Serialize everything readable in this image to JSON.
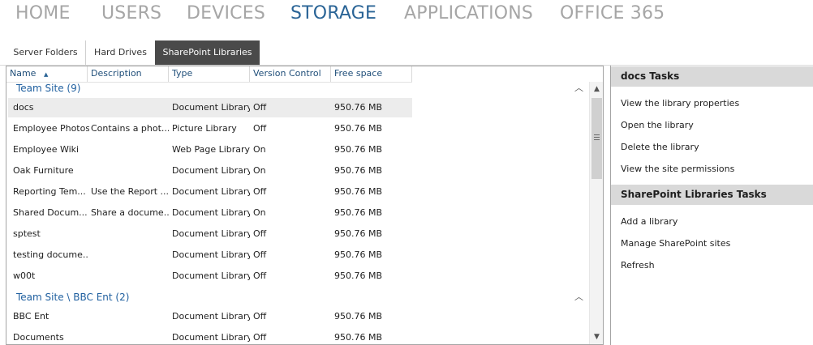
{
  "nav": {
    "items": [
      {
        "label": "HOME"
      },
      {
        "label": "USERS"
      },
      {
        "label": "DEVICES"
      },
      {
        "label": "STORAGE"
      },
      {
        "label": "APPLICATIONS"
      },
      {
        "label": "OFFICE 365"
      }
    ],
    "active": "STORAGE"
  },
  "tabs": {
    "items": [
      {
        "label": "Server Folders"
      },
      {
        "label": "Hard Drives"
      },
      {
        "label": "SharePoint Libraries"
      }
    ],
    "active": "SharePoint Libraries"
  },
  "list": {
    "columns": [
      {
        "label": "Name"
      },
      {
        "label": "Description"
      },
      {
        "label": "Type"
      },
      {
        "label": "Version Control"
      },
      {
        "label": "Free space"
      }
    ],
    "sort_column": "Name",
    "groups": [
      {
        "label": "Team Site (9)",
        "rows": [
          {
            "name": "docs",
            "description": "",
            "type": "Document Library",
            "version": "Off",
            "free": "950.76 MB",
            "selected": true
          },
          {
            "name": "Employee Photos",
            "description": "Contains a phot...",
            "type": "Picture Library",
            "version": "Off",
            "free": "950.76 MB"
          },
          {
            "name": "Employee Wiki",
            "description": "",
            "type": "Web Page Library",
            "version": "On",
            "free": "950.76 MB"
          },
          {
            "name": "Oak Furniture",
            "description": "",
            "type": "Document Library",
            "version": "On",
            "free": "950.76 MB"
          },
          {
            "name": "Reporting Tem...",
            "description": "Use the Report ...",
            "type": "Document Library",
            "version": "Off",
            "free": "950.76 MB"
          },
          {
            "name": "Shared Docum...",
            "description": "Share a docume...",
            "type": "Document Library",
            "version": "On",
            "free": "950.76 MB"
          },
          {
            "name": "sptest",
            "description": "",
            "type": "Document Library",
            "version": "Off",
            "free": "950.76 MB"
          },
          {
            "name": "testing docume...",
            "description": "",
            "type": "Document Library",
            "version": "Off",
            "free": "950.76 MB"
          },
          {
            "name": "w00t",
            "description": "",
            "type": "Document Library",
            "version": "Off",
            "free": "950.76 MB"
          }
        ]
      },
      {
        "label": "Team Site \\ BBC  Ent (2)",
        "rows": [
          {
            "name": "BBC Ent",
            "description": "",
            "type": "Document Library",
            "version": "Off",
            "free": "950.76 MB"
          },
          {
            "name": "Documents",
            "description": "",
            "type": "Document Library",
            "version": "Off",
            "free": "950.76 MB"
          }
        ]
      }
    ]
  },
  "tasks": {
    "sections": [
      {
        "title": "docs Tasks",
        "links": [
          {
            "label": "View the library properties"
          },
          {
            "label": "Open the library"
          },
          {
            "label": "Delete the library"
          },
          {
            "label": "View the site permissions"
          }
        ]
      },
      {
        "title": "SharePoint Libraries Tasks",
        "links": [
          {
            "label": "Add a library"
          },
          {
            "label": "Manage SharePoint sites"
          },
          {
            "label": "Refresh"
          }
        ]
      }
    ]
  },
  "icons": {
    "sort": "sort-ascending-icon",
    "collapse": "chevron-up-icon",
    "scroll_up": "chevron-up-icon",
    "scroll_down": "chevron-down-icon",
    "grip": "scroll-grip-icon"
  },
  "colors": {
    "nav_active": "#2a6496",
    "nav_inactive": "#a6a6a6",
    "tab_active_bg": "#4a4a4a",
    "group_label": "#1f5f9f",
    "column_header": "#1f4e79",
    "task_header_bg": "#d9d9d9"
  }
}
